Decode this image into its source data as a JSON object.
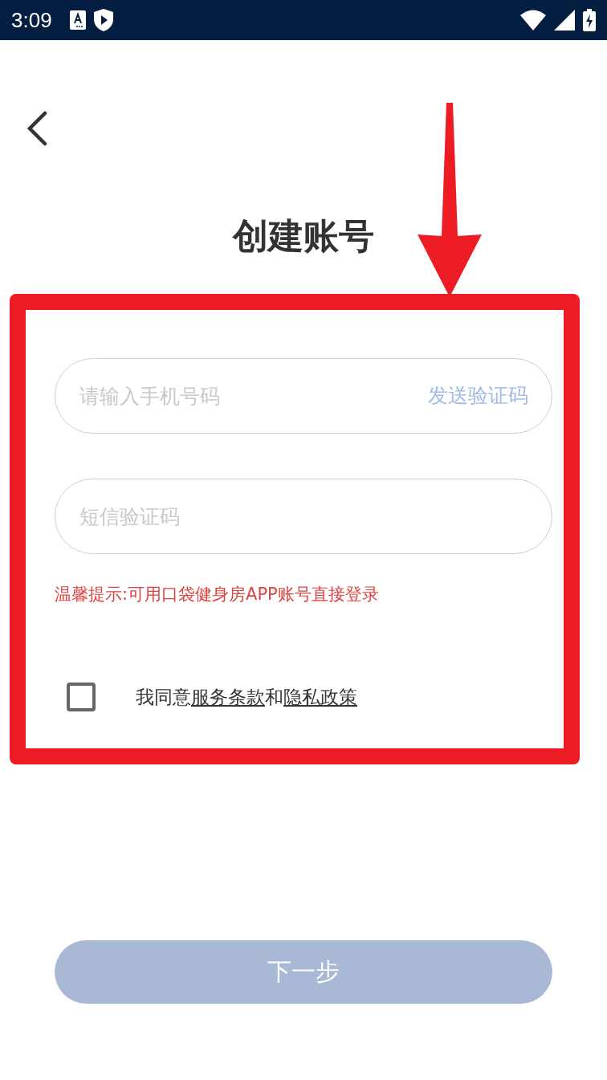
{
  "status_bar": {
    "time": "3:09"
  },
  "title": "创建账号",
  "phone_field": {
    "placeholder": "请输入手机号码",
    "action": "发送验证码"
  },
  "code_field": {
    "placeholder": "短信验证码"
  },
  "hint": "温馨提示:可用口袋健身房APP账号直接登录",
  "agreement": {
    "checked": false,
    "parts": [
      {
        "kind": "text",
        "text": "我同意"
      },
      {
        "kind": "link",
        "text": "服务条款"
      },
      {
        "kind": "text",
        "text": "和"
      },
      {
        "kind": "link",
        "text": "隐私政策"
      }
    ]
  },
  "next_button": {
    "label": "下一步",
    "disabled": true
  },
  "annotation": {
    "kind": "arrow-frame"
  }
}
